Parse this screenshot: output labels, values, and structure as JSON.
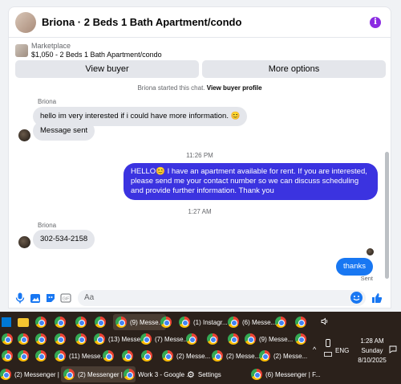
{
  "chat": {
    "title": "Briona · 2 Beds 1 Bath Apartment/condo",
    "listing_source": "Marketplace",
    "listing_price_title": "$1,050 - 2 Beds 1 Bath Apartment/condo",
    "view_buyer": "View buyer",
    "more_options": "More options",
    "started_text": "Briona started this chat.",
    "view_buyer_profile": "View buyer profile",
    "composer_placeholder": "Aa"
  },
  "messages": [
    {
      "sender": "Briona",
      "text": "hello im very interested if i could have more information. 😊"
    },
    {
      "text": "Message sent"
    },
    {
      "timestamp": "11:26 PM"
    },
    {
      "text": "HELLO😊 I have an apartment available for rent. If you are interested, please send me your contact number so we can discuss scheduling and provide further information. Thank you"
    },
    {
      "timestamp": "1:27 AM"
    },
    {
      "sender": "Briona",
      "text": "302-534-2158"
    },
    {
      "text": "thanks",
      "status": "Sent"
    }
  ],
  "taskbar": {
    "row1": [
      "(9) Messe...",
      "(1) Instagr...",
      "(6) Messe..."
    ],
    "row2": [
      "(13) Messe...",
      "(7) Messe...",
      "(9) Messe..."
    ],
    "row3": [
      "(11) Messe...",
      "(2) Messe...",
      "(2) Messe...",
      "(2) Messe..."
    ],
    "row4": [
      "(2) Messenger | F...",
      "(2) Messenger | F...",
      "Work 3 - Google ...",
      "Settings",
      "(6) Messenger | F..."
    ]
  },
  "tray": {
    "lang": "ENG",
    "time": "1:28 AM",
    "day": "Sunday",
    "date": "8/10/2025"
  },
  "colors": {
    "outgoing_bubble": "#3b33e0",
    "accent": "#1877f2",
    "info_icon": "#8a2be2",
    "taskbar_bg": "#2b211b"
  }
}
